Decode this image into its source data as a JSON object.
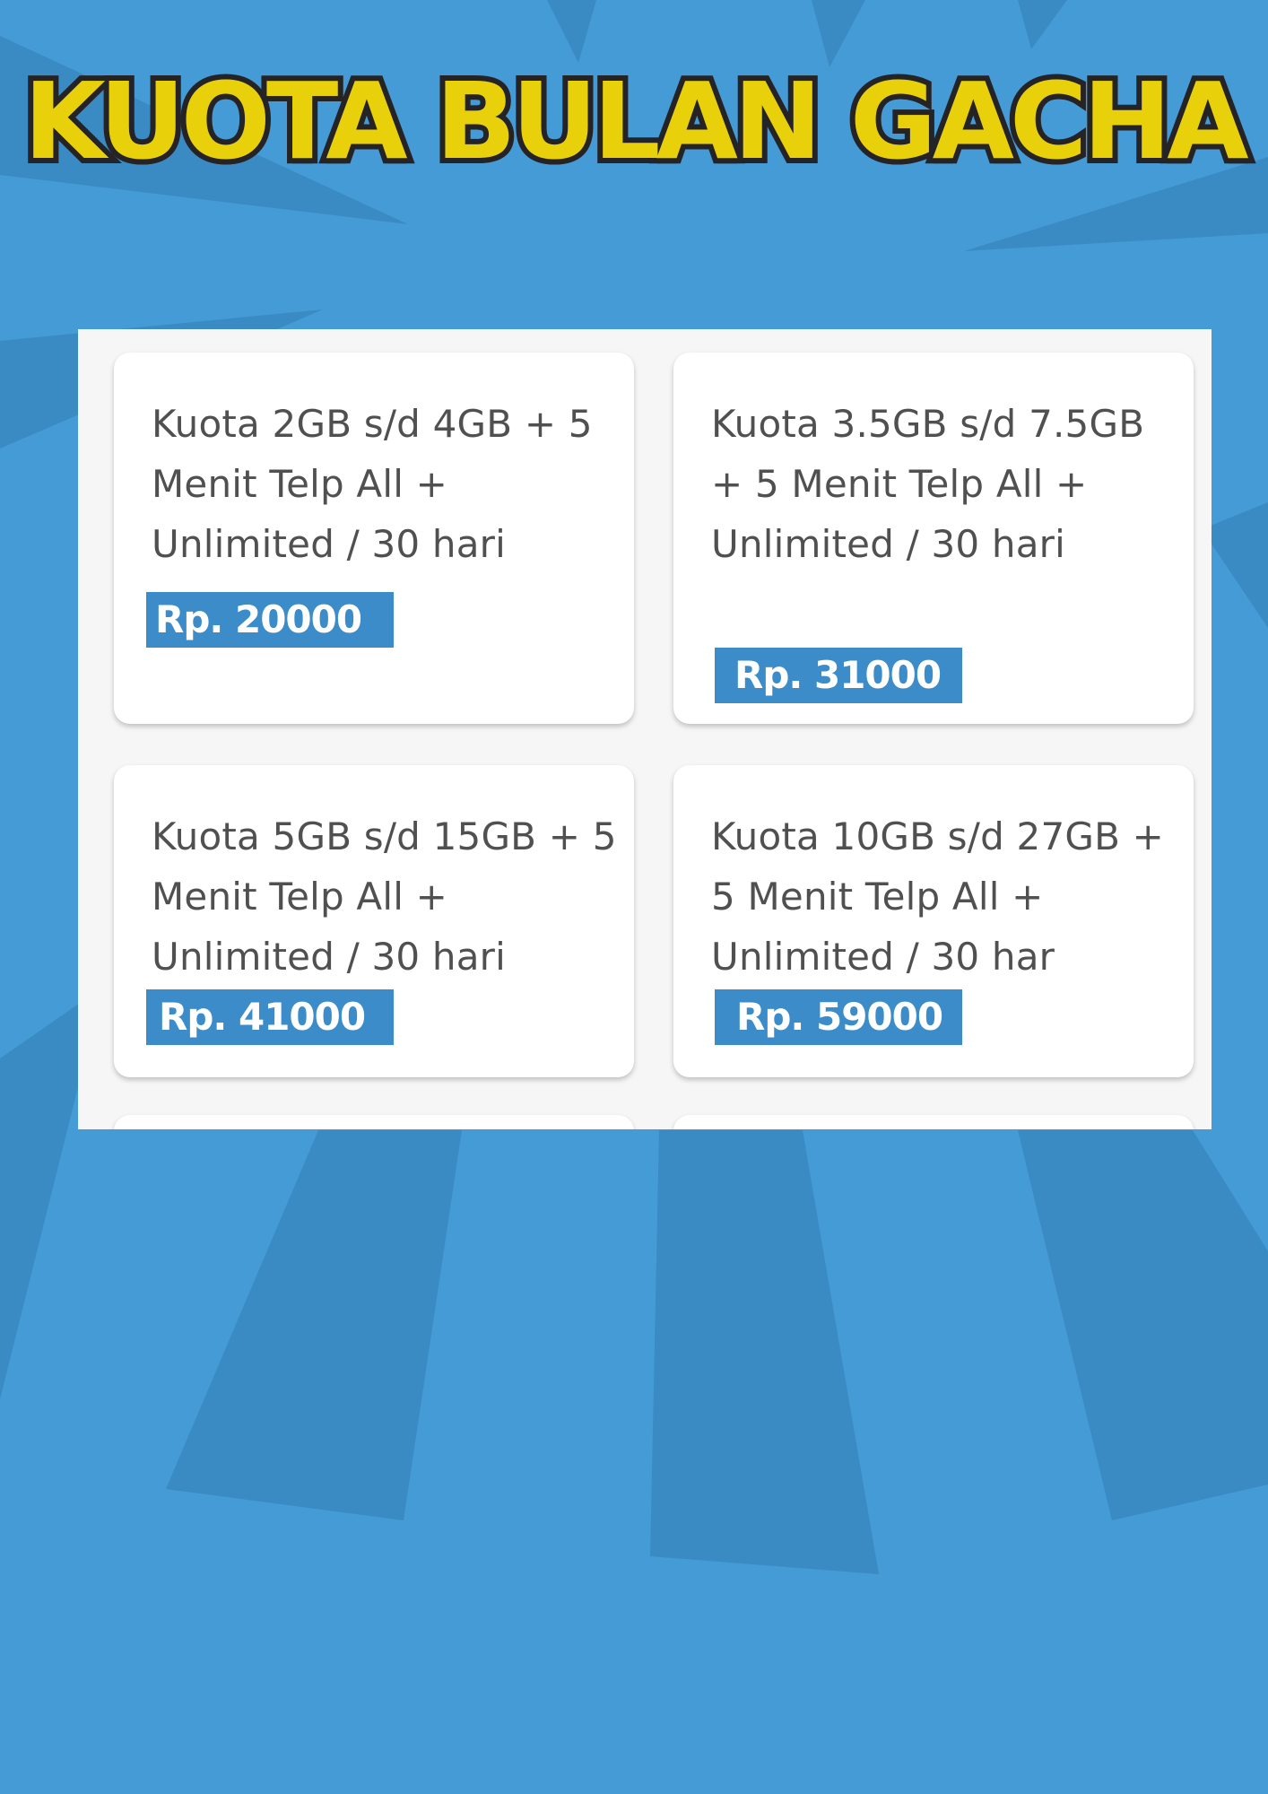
{
  "colors": {
    "background": "#449bd6",
    "ray": "#3a8bc4",
    "title_fill": "#e8d10b",
    "title_outline": "#262326",
    "card_background": "#ffffff",
    "panel_background": "#f6f6f6",
    "price_tag": "#3b8cc9",
    "description_text": "#505050"
  },
  "header": {
    "title": "KUOTA BULAN GACHA"
  },
  "packages": [
    {
      "description": "Kuota 2GB s/d 4GB + 5 Menit Telp All + Unlimited / 30 hari",
      "price": "Rp. 20000"
    },
    {
      "description": "Kuota 3.5GB s/d 7.5GB + 5 Menit Telp All + Unlimited / 30 hari",
      "price": "Rp. 31000"
    },
    {
      "description": "Kuota 5GB s/d 15GB + 5 Menit Telp All + Unlimited / 30 hari",
      "price": "Rp. 41000"
    },
    {
      "description": "Kuota 10GB s/d 27GB + 5 Menit Telp All + Unlimited / 30 har",
      "price": "Rp. 59000"
    }
  ]
}
